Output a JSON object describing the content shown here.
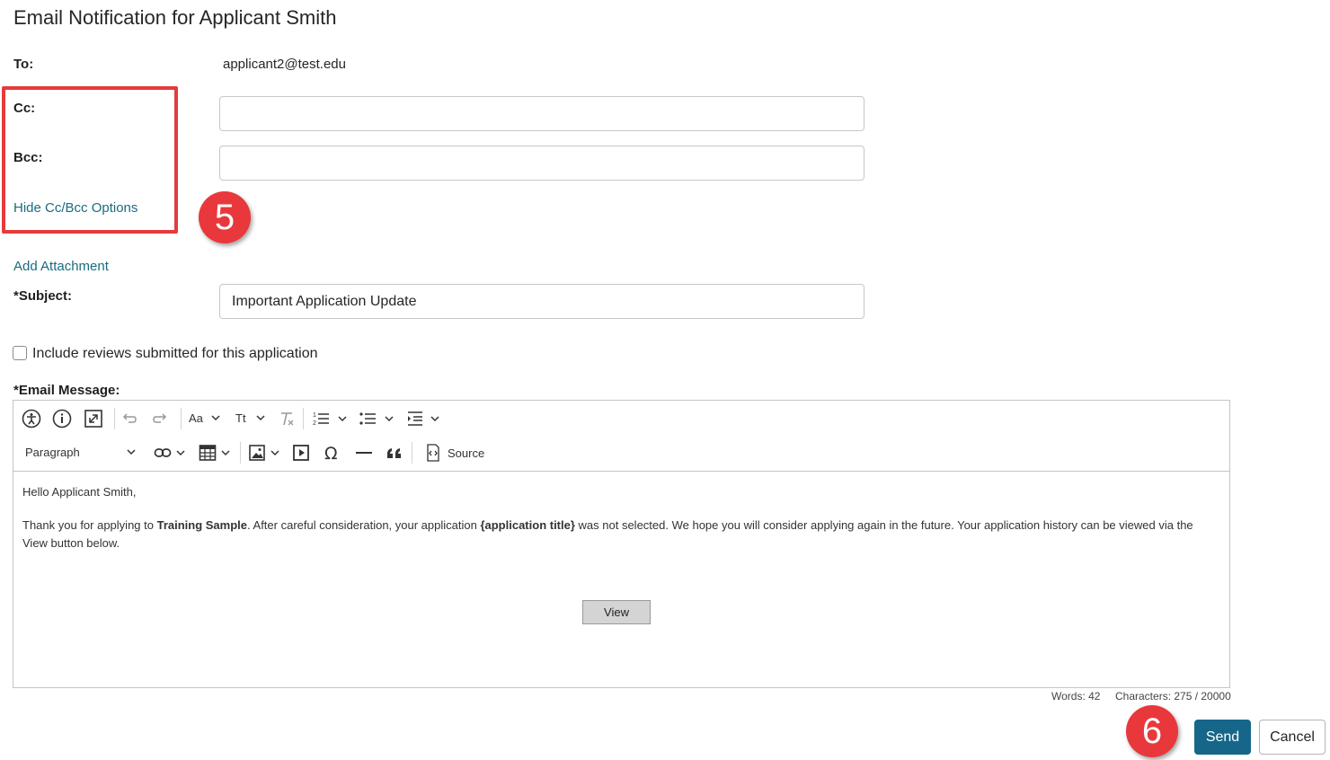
{
  "title": "Email Notification for Applicant Smith",
  "to": {
    "label": "To:",
    "value": "applicant2@test.edu"
  },
  "cc": {
    "label": "Cc:",
    "value": ""
  },
  "bcc": {
    "label": "Bcc:",
    "value": ""
  },
  "hide_cc_bcc_link": "Hide Cc/Bcc Options",
  "add_attachment_link": "Add Attachment",
  "subject": {
    "label": "*Subject:",
    "value": "Important Application Update"
  },
  "include_reviews": {
    "label": "Include reviews submitted for this application",
    "checked": false
  },
  "message": {
    "label": "*Email Message:",
    "toolbar": {
      "row1": [
        "accessibility-icon",
        "info-icon",
        "fullscreen-icon",
        "undo-icon",
        "redo-icon",
        "font-size-icon",
        "text-transform-icon",
        "remove-format-icon",
        "numbered-list-icon",
        "bulleted-list-icon",
        "indent-icon"
      ],
      "font_size_label": "Aa",
      "text_transform_label": "Tt",
      "block_format": "Paragraph",
      "source_label": "Source",
      "row2": [
        "link-icon",
        "table-icon",
        "image-icon",
        "media-icon",
        "special-char-icon",
        "horizontal-line-icon",
        "blockquote-icon",
        "source-icon"
      ]
    },
    "greeting": "Hello Applicant Smith,",
    "body_part1": "Thank you for applying to ",
    "program_name": "Training Sample",
    "body_part2": ". After careful consideration, your application ",
    "app_title_token": "{application title}",
    "body_part3": " was not selected. We hope you will consider applying again in the future. Your application history can be viewed via the View button below.",
    "view_button": "View",
    "words": "Words: 42",
    "characters": "Characters: 275 / 20000"
  },
  "callouts": [
    "5",
    "6"
  ],
  "actions": {
    "send": "Send",
    "cancel": "Cancel"
  },
  "colors": {
    "accent": "#16668a",
    "link": "#1a6b80",
    "callout": "#e8383b",
    "highlight_box": "#e53b3b"
  }
}
